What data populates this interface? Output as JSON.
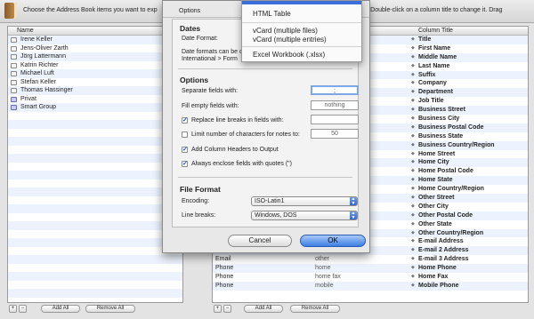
{
  "header": {
    "instruction_left": "Choose the Address Book items you want to exp",
    "instruction_right": "rt. Double-click on a column title to change it. Drag"
  },
  "left_panel": {
    "column_title": "Name",
    "items": [
      {
        "label": "Irene Keller",
        "icon": "contact-card-icon"
      },
      {
        "label": "Jens-Oliver Zarth",
        "icon": "contact-card-icon"
      },
      {
        "label": "Jörg Lattermann",
        "icon": "contact-card-icon"
      },
      {
        "label": "Katrin Richter",
        "icon": "contact-card-icon"
      },
      {
        "label": "Michael Luft",
        "icon": "contact-card-icon"
      },
      {
        "label": "Stefan Keller",
        "icon": "contact-card-icon"
      },
      {
        "label": "Thomas Hassinger",
        "icon": "contact-card-icon"
      },
      {
        "label": "Privat",
        "icon": "group-icon"
      },
      {
        "label": "Smart Group",
        "icon": "smart-group-icon"
      }
    ],
    "add_label": "+",
    "remove_label": "−",
    "add_all_label": "Add All",
    "remove_all_label": "Remove All"
  },
  "right_panel": {
    "column_title": "Column Title",
    "rows": [
      {
        "field": "",
        "label": "",
        "title": "Title"
      },
      {
        "field": "",
        "label": "",
        "title": "First Name"
      },
      {
        "field": "",
        "label": "",
        "title": "Middle Name"
      },
      {
        "field": "",
        "label": "",
        "title": "Last Name"
      },
      {
        "field": "",
        "label": "",
        "title": "Suffix"
      },
      {
        "field": "",
        "label": "",
        "title": "Company"
      },
      {
        "field": "",
        "label": "",
        "title": "Department"
      },
      {
        "field": "",
        "label": "",
        "title": "Job Title"
      },
      {
        "field": "",
        "label": "",
        "title": "Business Street"
      },
      {
        "field": "",
        "label": "",
        "title": "Business City"
      },
      {
        "field": "",
        "label": "",
        "title": "Business Postal Code"
      },
      {
        "field": "",
        "label": "",
        "title": "Business State"
      },
      {
        "field": "",
        "label": "",
        "title": "Business Country/Region"
      },
      {
        "field": "",
        "label": "",
        "title": "Home Street"
      },
      {
        "field": "",
        "label": "",
        "title": "Home City"
      },
      {
        "field": "",
        "label": "",
        "title": "Home Postal Code"
      },
      {
        "field": "",
        "label": "",
        "title": "Home State"
      },
      {
        "field": "",
        "label": "",
        "title": "Home Country/Region"
      },
      {
        "field": "",
        "label": "",
        "title": "Other Street"
      },
      {
        "field": "",
        "label": "",
        "title": "Other City"
      },
      {
        "field": "",
        "label": "",
        "title": "Other Postal Code"
      },
      {
        "field": "",
        "label": "",
        "title": "Other State"
      },
      {
        "field": "",
        "label": "",
        "title": "Other Country/Region"
      },
      {
        "field": "",
        "label": "",
        "title": "E-mail Address"
      },
      {
        "field": "",
        "label": "",
        "title": "E-mail 2 Address"
      },
      {
        "field": "Email",
        "label": "other",
        "title": "E-mail 3 Address"
      },
      {
        "field": "Phone",
        "label": "home",
        "title": "Home Phone"
      },
      {
        "field": "Phone",
        "label": "home fax",
        "title": "Home Fax"
      },
      {
        "field": "Phone",
        "label": "mobile",
        "title": "Mobile Phone"
      }
    ],
    "add_label": "+",
    "remove_label": "−",
    "add_all_label": "Add All",
    "remove_all_label": "Remove All"
  },
  "options_sheet": {
    "tab_label": "Options",
    "dates_heading": "Dates",
    "date_format_label": "Date Format:",
    "date_note_line1": "Date formats can be c",
    "date_note_line2": "International > Form",
    "options_heading": "Options",
    "separate_label": "Separate fields with:",
    "separate_value": ";",
    "fill_empty_label": "Fill empty fields with:",
    "fill_empty_value": "nothing",
    "replace_breaks_label": "Replace line breaks in fields with:",
    "replace_breaks_checked": true,
    "limit_chars_label": "Limit number of characters for notes to:",
    "limit_chars_checked": false,
    "limit_chars_value": "50",
    "add_headers_label": "Add Column Headers to Output",
    "add_headers_checked": true,
    "enclose_quotes_label": "Always enclose fields with quotes (\")",
    "enclose_quotes_checked": true,
    "file_format_heading": "File Format",
    "encoding_label": "Encoding:",
    "encoding_value": "ISO-Latin1",
    "line_breaks_label": "Line breaks:",
    "line_breaks_value": "Windows, DOS",
    "cancel_label": "Cancel",
    "ok_label": "OK",
    "check_glyph": "✓"
  },
  "format_menu": {
    "items": [
      "HTML Table",
      "vCard (multiple files)",
      "vCard (multiple entries)",
      "Excel Workbook (.xlsx)"
    ]
  },
  "colors": {
    "selection_blue": "#3b6ed9",
    "row_stripe": "#edf3fe",
    "default_button": "#3d7ee3"
  }
}
